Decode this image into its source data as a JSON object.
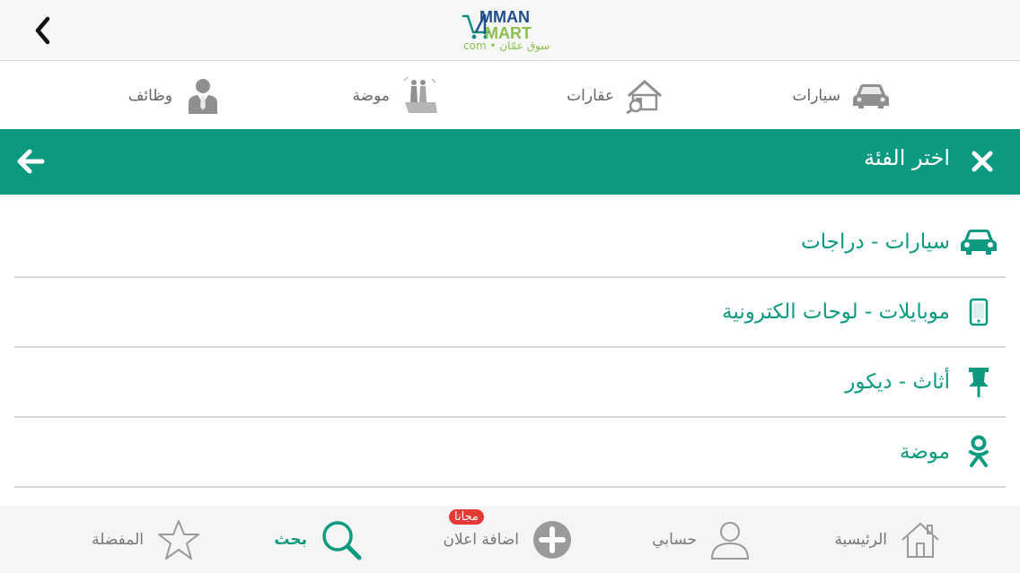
{
  "header": {
    "logo_top": "MMAN",
    "logo_bottom": "MART",
    "logo_tagline": "سوق عمّان • com"
  },
  "top_categories": [
    {
      "label": "سيارات",
      "icon": "car-icon"
    },
    {
      "label": "عقارات",
      "icon": "house-icon"
    },
    {
      "label": "موضة",
      "icon": "fashion-icon"
    },
    {
      "label": "وظائف",
      "icon": "businessman-icon"
    }
  ],
  "category_panel": {
    "title": "اختر الفئة"
  },
  "categories": [
    {
      "label": "سيارات - دراجات",
      "icon": "car-icon"
    },
    {
      "label": "موبايلات - لوحات الكترونية",
      "icon": "mobile-icon"
    },
    {
      "label": "أثاث - ديكور",
      "icon": "pin-icon"
    },
    {
      "label": "موضة",
      "icon": "odnoklassniki-icon"
    }
  ],
  "bottom_nav": {
    "home": "الرئيسية",
    "account": "حسابي",
    "add_ad": "اضافة اعلان",
    "add_ad_badge": "مجانا",
    "search": "بحث",
    "favorites": "المفضلة"
  },
  "colors": {
    "accent": "#0b9a80",
    "badge": "#e53935"
  }
}
